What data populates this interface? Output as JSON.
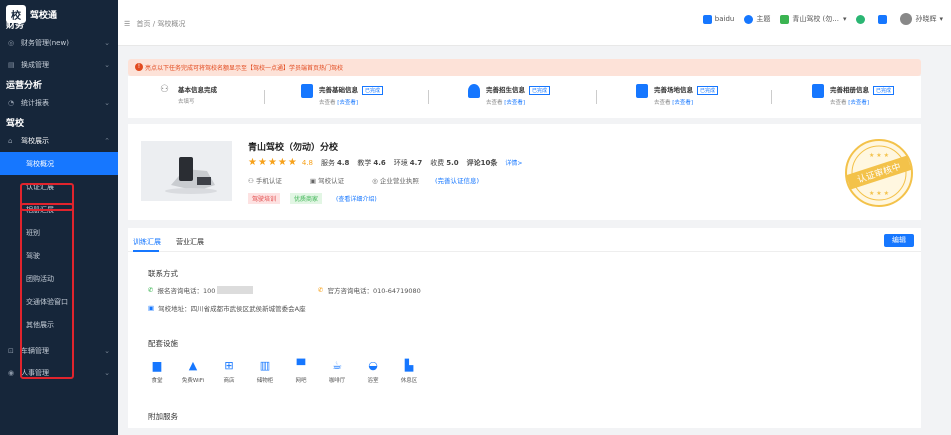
{
  "app": {
    "logo_text": "驾校通",
    "logo_mark": "校"
  },
  "sidebar": {
    "sections": [
      {
        "title": "财务"
      },
      {
        "title": "运营分析"
      },
      {
        "title": "驾校"
      }
    ],
    "items": {
      "finance_manage": "财务管理(new)",
      "order_manage": "换成管理",
      "stats_report": "统计报表",
      "school_display": "驾校展示",
      "vehicle_manage": "车辆管理",
      "staff_manage": "人事管理"
    },
    "sub_items": [
      "驾校概况",
      "认证汇展",
      "相册汇展",
      "班别",
      "驾驶",
      "团购活动",
      "交通体验窗口",
      "其他展示"
    ]
  },
  "topbar": {
    "breadcrumb": "首页 / 驾校概况",
    "items": [
      "baidu",
      "主题",
      "青山驾校 (勿...",
      "孙晓辉"
    ]
  },
  "notice": {
    "text": "亮点以下任务完成可将驾校名额显示至【驾校一点通】学员端首页热门驾校"
  },
  "steps": [
    {
      "title": "基本信息完成",
      "sub": "去填写",
      "link": ""
    },
    {
      "title": "完善基础信息",
      "tag": "已完成",
      "sub": "去查看",
      "link": "[去查看]"
    },
    {
      "title": "完善招生信息",
      "tag": "已完成",
      "sub": "去查看",
      "link": "[去查看]"
    },
    {
      "title": "完善场地信息",
      "tag": "已完成",
      "sub": "去查看",
      "link": "[去查看]"
    },
    {
      "title": "完善相册信息",
      "tag": "已完成",
      "sub": "去查看",
      "link": "[去查看]"
    }
  ],
  "school": {
    "name": "青山驾校（勿动）分校",
    "rating": "4.8",
    "scores": [
      {
        "label": "服务",
        "value": "4.8"
      },
      {
        "label": "教学",
        "value": "4.6"
      },
      {
        "label": "环境",
        "value": "4.7"
      },
      {
        "label": "收费",
        "value": "5.0"
      }
    ],
    "reviews": "评论10条",
    "reviews_link": "详情>",
    "verify": [
      "手机认证",
      "驾校认证",
      "企业营业执照",
      "(完善认证信息)"
    ],
    "badges": [
      "驾驶培训",
      "优质商家",
      "(查看详细介绍)"
    ],
    "seal_text": "认证审核中"
  },
  "tabs": {
    "items": [
      "训练汇展",
      "营业汇展"
    ],
    "edit": "编辑"
  },
  "detail": {
    "contact_title": "联系方式",
    "phone_label": "报名咨询电话：100",
    "hotline": "官方咨询电话：010-64719080",
    "address": "驾校地址：四川省成都市武侯区武侯新城管委会A座",
    "facilities_title": "配套设施",
    "facilities": [
      {
        "label": "食堂",
        "icon": "canteen-icon"
      },
      {
        "label": "免费WiFi",
        "icon": "wifi-icon"
      },
      {
        "label": "商店",
        "icon": "shop-icon"
      },
      {
        "label": "储物柜",
        "icon": "locker-icon"
      },
      {
        "label": "网吧",
        "icon": "computer-icon"
      },
      {
        "label": "咖啡厅",
        "icon": "coffee-icon"
      },
      {
        "label": "浴室",
        "icon": "bath-icon"
      },
      {
        "label": "休息区",
        "icon": "rest-icon"
      }
    ],
    "extra_title": "附加服务"
  },
  "colors": {
    "sidebar": "#16263a",
    "accent": "#1677ff",
    "highlight": "#e0242d",
    "notice_bg": "#fde2d8"
  }
}
